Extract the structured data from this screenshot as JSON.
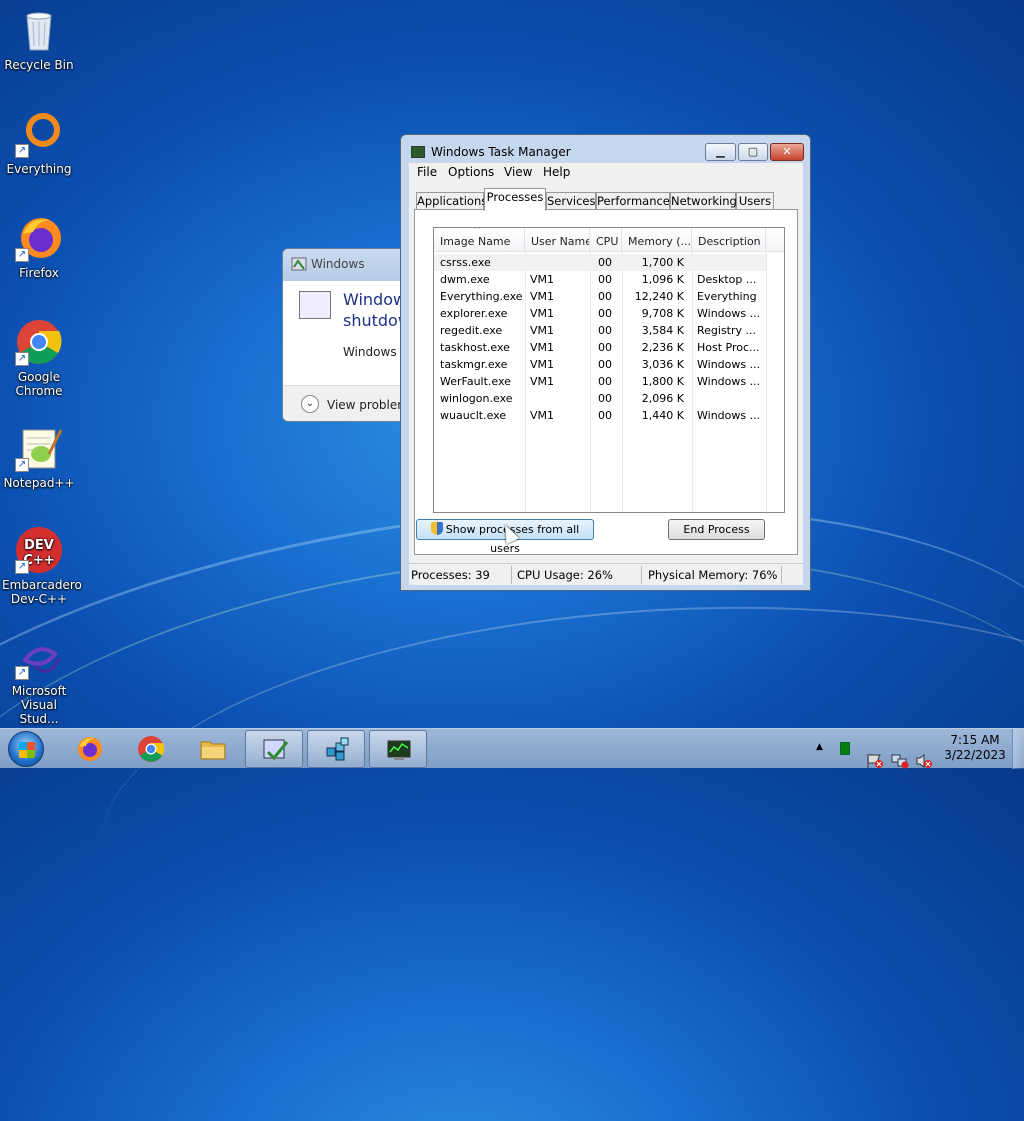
{
  "desktop": {
    "icons": [
      {
        "label": "Recycle Bin"
      },
      {
        "label": "Everything"
      },
      {
        "label": "Firefox"
      },
      {
        "label": "Google Chrome"
      },
      {
        "label": "Notepad++"
      },
      {
        "label": "Embarcadero Dev-C++"
      },
      {
        "label": "Microsoft Visual Stud..."
      }
    ],
    "shortcut_glyph": "↗"
  },
  "bg_dialog": {
    "title": "Windows",
    "heading_line1": "Window",
    "heading_line2": "shutdow",
    "text": "Windows c",
    "footer": "View problem",
    "chevron": "⌄"
  },
  "task_manager": {
    "title": "Windows Task Manager",
    "caption": {
      "minimize": "▁",
      "maximize": "▢",
      "close": "✕"
    },
    "menu": [
      "File",
      "Options",
      "View",
      "Help"
    ],
    "tabs": [
      "Applications",
      "Processes",
      "Services",
      "Performance",
      "Networking",
      "Users"
    ],
    "active_tab": "Processes",
    "sort_arrow": "^",
    "columns": [
      "Image Name",
      "User Name",
      "CPU",
      "Memory (...",
      "Description"
    ],
    "rows": [
      {
        "image": "csrss.exe",
        "user": "",
        "cpu": "00",
        "mem": "1,700 K",
        "desc": ""
      },
      {
        "image": "dwm.exe",
        "user": "VM1",
        "cpu": "00",
        "mem": "1,096 K",
        "desc": "Desktop ..."
      },
      {
        "image": "Everything.exe",
        "user": "VM1",
        "cpu": "00",
        "mem": "12,240 K",
        "desc": "Everything"
      },
      {
        "image": "explorer.exe",
        "user": "VM1",
        "cpu": "00",
        "mem": "9,708 K",
        "desc": "Windows ..."
      },
      {
        "image": "regedit.exe",
        "user": "VM1",
        "cpu": "00",
        "mem": "3,584 K",
        "desc": "Registry ..."
      },
      {
        "image": "taskhost.exe",
        "user": "VM1",
        "cpu": "00",
        "mem": "2,236 K",
        "desc": "Host Proc..."
      },
      {
        "image": "taskmgr.exe",
        "user": "VM1",
        "cpu": "00",
        "mem": "3,036 K",
        "desc": "Windows ..."
      },
      {
        "image": "WerFault.exe",
        "user": "VM1",
        "cpu": "00",
        "mem": "1,800 K",
        "desc": "Windows ..."
      },
      {
        "image": "winlogon.exe",
        "user": "",
        "cpu": "00",
        "mem": "2,096 K",
        "desc": ""
      },
      {
        "image": "wuauclt.exe",
        "user": "VM1",
        "cpu": "00",
        "mem": "1,440 K",
        "desc": "Windows ..."
      }
    ],
    "show_all_label": "Show processes from all users",
    "end_process_label": "End Process",
    "status": {
      "processes": "Processes: 39",
      "cpu": "CPU Usage: 26%",
      "memory": "Physical Memory: 76%"
    }
  },
  "taskbar": {
    "tray_arrow": "▲",
    "time": "7:15 AM",
    "date": "3/22/2023"
  },
  "colors": {
    "accent": "#1e3287",
    "taskbar": "#8fabd0",
    "desktop": "#1a6fd0"
  }
}
